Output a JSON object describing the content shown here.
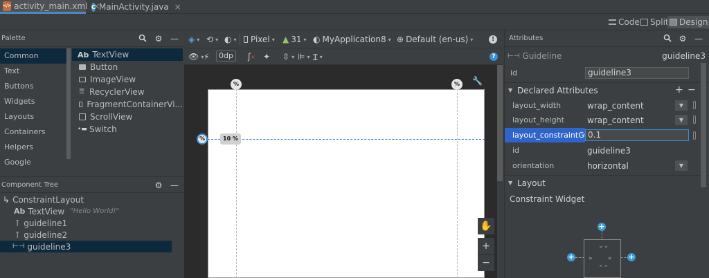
{
  "tabs": [
    {
      "label": "activity_main.xml",
      "icon": "xml-file-icon",
      "active": true
    },
    {
      "label": "MainActivity.java",
      "icon": "java-class-icon",
      "active": false
    }
  ],
  "view_modes": {
    "code": "Code",
    "split": "Split",
    "design": "Design"
  },
  "palette": {
    "title": "Palette",
    "categories": [
      "Common",
      "Text",
      "Buttons",
      "Widgets",
      "Layouts",
      "Containers",
      "Helpers",
      "Google"
    ],
    "items": [
      {
        "label": "TextView",
        "prefix": "Ab"
      },
      {
        "label": "Button"
      },
      {
        "label": "ImageView"
      },
      {
        "label": "RecyclerView"
      },
      {
        "label": "FragmentContainerVi..."
      },
      {
        "label": "ScrollView"
      },
      {
        "label": "Switch"
      }
    ]
  },
  "component_tree": {
    "title": "Component Tree",
    "items": [
      {
        "label": "ConstraintLayout"
      },
      {
        "label": "TextView",
        "prefix": "Ab",
        "hint": "\"Hello World!\""
      },
      {
        "label": "guideline1"
      },
      {
        "label": "guideline2"
      },
      {
        "label": "guideline3"
      }
    ]
  },
  "design_toolbar": {
    "device": "Pixel",
    "api": "31",
    "app": "MyApplication8",
    "locale": "Default (en-us)",
    "margin": "0dp"
  },
  "canvas": {
    "guide_badge": "%",
    "guide_label": "10 %"
  },
  "attributes": {
    "title": "Attributes",
    "component_type": "Guideline",
    "component_id": "guideline3",
    "id_label": "id",
    "id_value": "guideline3",
    "declared_title": "Declared Attributes",
    "declared": [
      {
        "name": "layout_width",
        "value": "wrap_content"
      },
      {
        "name": "layout_height",
        "value": "wrap_content"
      },
      {
        "name": "layout_constraintGui...",
        "value": "0.1"
      },
      {
        "name": "id",
        "value": "guideline3"
      },
      {
        "name": "orientation",
        "value": "horizontal"
      }
    ],
    "layout_title": "Layout",
    "constraint_widget": "Constraint Widget"
  },
  "colors": {
    "accent": "#3a8fd6",
    "selection": "#0d293e",
    "panel": "#3c3f41",
    "canvas": "#2b2b2b"
  }
}
